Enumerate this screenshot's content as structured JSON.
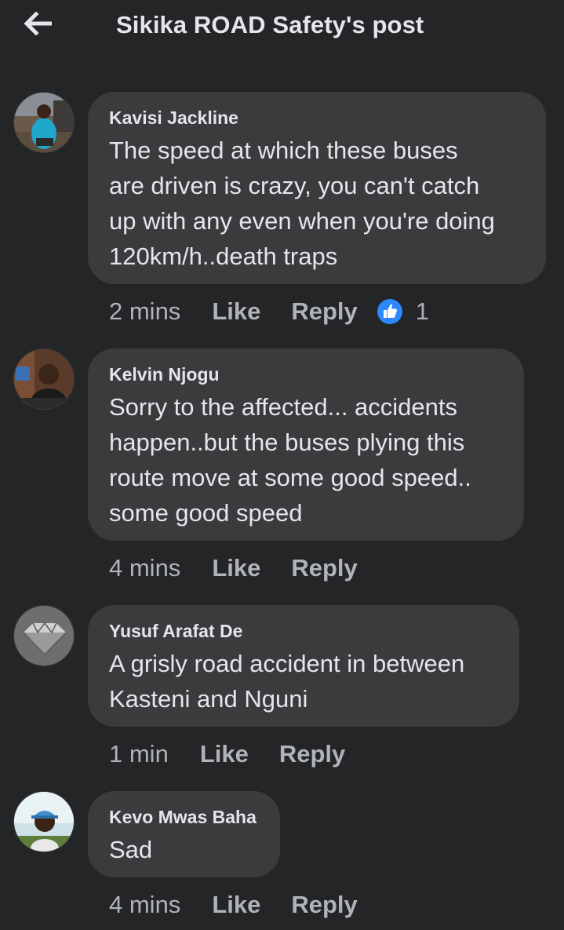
{
  "header": {
    "back_icon": "arrow-left-icon",
    "title": "Sikika ROAD Safety's post"
  },
  "comments": [
    {
      "author": "Kavisi Jackline",
      "text": "The speed at which these buses\nare driven is crazy, you can't catch\nup with any even when you're doing\n120km/h..death traps",
      "time": "2 mins",
      "like": "Like",
      "reply": "Reply",
      "reaction_icon": "thumbs-up-icon",
      "reaction_count": "1"
    },
    {
      "author": "Kelvin Njogu",
      "text": "Sorry to the affected... accidents\nhappen..but the buses plying this\nroute move at some good speed..\nsome good speed",
      "time": "4 mins",
      "like": "Like",
      "reply": "Reply"
    },
    {
      "author": "Yusuf Arafat De",
      "text": "A grisly road accident in between\nKasteni and Nguni",
      "time": "1 min",
      "like": "Like",
      "reply": "Reply"
    },
    {
      "author": "Kevo Mwas Baha",
      "text": "Sad",
      "time": "4 mins",
      "like": "Like",
      "reply": "Reply"
    }
  ],
  "colors": {
    "background": "#242526",
    "bubble": "#3a3b3c",
    "primary_text": "#e4e6eb",
    "secondary_text": "#b0b3b8",
    "like_blue": "#2d88ff"
  }
}
